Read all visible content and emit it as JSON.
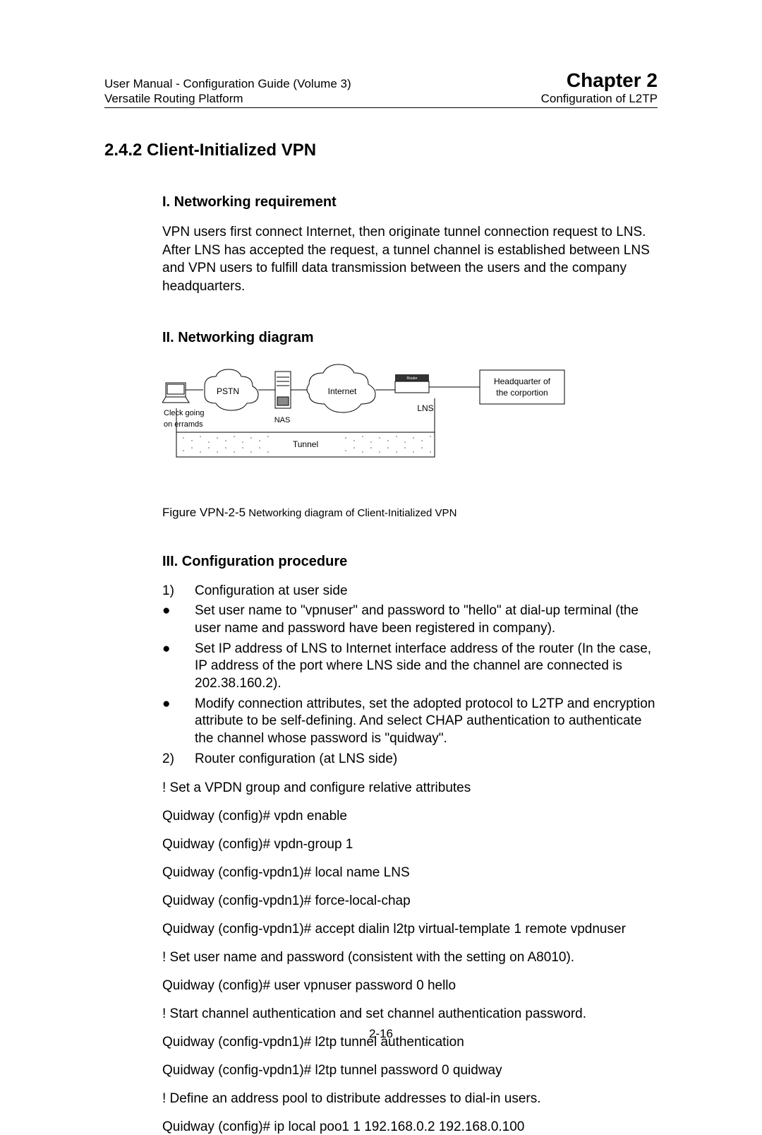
{
  "header": {
    "left1": "User Manual - Configuration Guide (Volume 3)",
    "left2": "Versatile Routing Platform",
    "right1": "Chapter 2",
    "right2": "Configuration of L2TP"
  },
  "section_num": "2.4.2  Client-Initialized VPN",
  "h_req": "I. Networking requirement",
  "p_req": "VPN users first connect Internet, then originate tunnel connection request to LNS. After LNS has accepted the request, a tunnel channel is established between LNS and VPN users to fulfill data transmission between the users and the company headquarters.",
  "h_diag": "II. Networking diagram",
  "diagram_labels": {
    "pstn": "PSTN",
    "internet": "Internet",
    "lns": "LNS",
    "nas": "NAS",
    "tunnel": "Tunnel",
    "clerk1": "Cleck going",
    "clerk2": "on  erramds",
    "hq1": "Headquarter of",
    "hq2": "the corportion"
  },
  "fig_cap_lead": "Figure VPN-2-5",
  "fig_cap_txt": "  Networking diagram of Client-Initialized VPN",
  "h_conf": "III. Configuration procedure",
  "list": [
    {
      "m": "1)",
      "t": "Configuration at user side"
    },
    {
      "m": "●",
      "t": "Set user name to \"vpnuser\" and password to \"hello\" at dial-up terminal (the user name and password have been registered in company)."
    },
    {
      "m": "●",
      "t": "Set IP address of LNS to Internet interface address of the router (In the case, IP address of the port where LNS side and the channel are connected is 202.38.160.2)."
    },
    {
      "m": "●",
      "t": "Modify connection attributes, set the adopted protocol to L2TP and encryption attribute to be self-defining. And select CHAP authentication to authenticate the channel whose password is \"quidway\"."
    },
    {
      "m": "2)",
      "t": "Router configuration (at LNS side)"
    }
  ],
  "cmds": [
    "! Set a VPDN group and configure relative attributes",
    "Quidway (config)# vpdn enable",
    "Quidway (config)# vpdn-group 1",
    "Quidway (config-vpdn1)# local name LNS",
    "Quidway (config-vpdn1)# force-local-chap",
    "Quidway (config-vpdn1)# accept dialin l2tp virtual-template 1 remote vpdnuser",
    "! Set user name and password (consistent with the setting on A8010).",
    "Quidway (config)# user vpnuser password 0 hello",
    "! Start channel authentication and set channel authentication password.",
    "Quidway (config-vpdn1)# l2tp tunnel authentication",
    "Quidway (config-vpdn1)# l2tp tunnel password  0  quidway",
    "! Define an address pool to distribute addresses to dial-in users.",
    "Quidway (config)# ip local poo1 1 192.168.0.2 192.168.0.100"
  ],
  "footer": "2-16"
}
